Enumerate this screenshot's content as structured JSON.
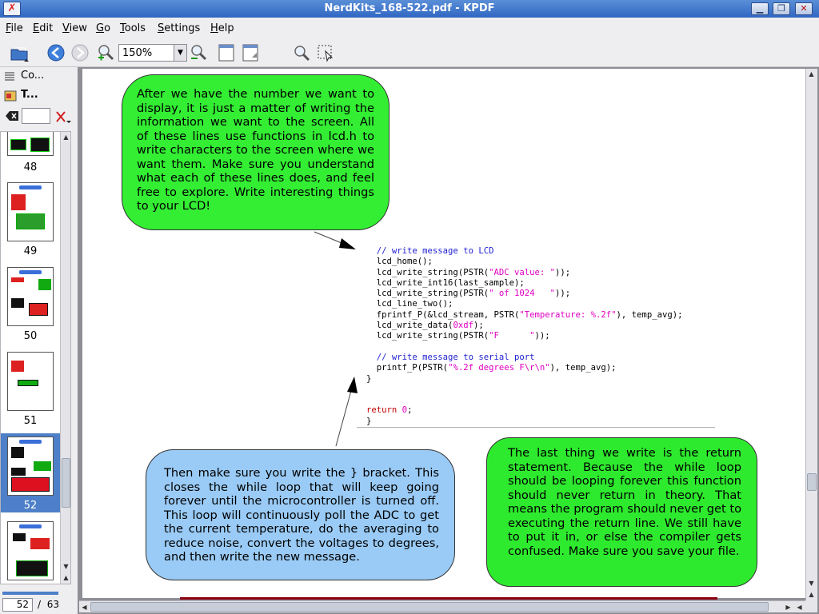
{
  "window": {
    "title": "NerdKits_168-522.pdf - KPDF",
    "app_icon_glyph": "✗"
  },
  "menu": {
    "items": [
      "File",
      "Edit",
      "View",
      "Go",
      "Tools",
      "Settings",
      "Help"
    ]
  },
  "toolbar": {
    "zoom_value": "150%"
  },
  "left_panel": {
    "tab_contents_label": "Co...",
    "tab_thumbnails_label": "T...",
    "thumbnail_pages": [
      "48",
      "49",
      "50",
      "51",
      "52"
    ],
    "selected_page": "52",
    "current_page": "52",
    "page_separator": "/",
    "total_pages": "63"
  },
  "document": {
    "bubble_top": "After we have the number we want to display, it is just a matter of writing the information we want to the screen. All of these lines use functions in lcd.h to write characters to the screen where we want them. Make sure you understand what each of these lines does, and feel free to explore. Write interesting things to your LCD!",
    "bubble_bottom_left": "Then make sure you write the } bracket. This closes the while loop that will keep going forever until the microcontroller is turned off. This loop will continuously poll the ADC to get the current temperature, do the averaging to reduce noise, convert the voltages to degrees, and then write the new message.",
    "bubble_bottom_right": "The last thing we write is the return statement. Because the while loop should be looping forever this function should never return in theory. That means the program should never get to executing the return line. We still have to put it in, or else the compiler gets confused. Make sure you save your file.",
    "code": {
      "l1_comment": "// write message to LCD",
      "l2": "lcd_home();",
      "l3_a": "lcd_write_string(PSTR(",
      "l3_str": "\"ADC value: \"",
      "l3_b": "));",
      "l4": "lcd_write_int16(last_sample);",
      "l5_a": "lcd_write_string(PSTR(",
      "l5_str": "\" of 1024   \"",
      "l5_b": "));",
      "l6": "lcd_line_two();",
      "l7_a": "fprintf_P(&lcd_stream, PSTR(",
      "l7_str": "\"Temperature: %.2f\"",
      "l7_b": "), temp_avg);",
      "l8_a": "lcd_write_data(",
      "l8_str": "0xdf",
      "l8_b": ");",
      "l9_a": "lcd_write_string(PSTR(",
      "l9_str": "\"F      \"",
      "l9_b": "));",
      "l10_comment": "// write message to serial port",
      "l11_a": "printf_P(PSTR(",
      "l11_str": "\"%.2f degrees F\\r\\n\"",
      "l11_b": "), temp_avg);",
      "l12": "}",
      "l13_kw": "return",
      "l13_num": "0",
      "l13_b": ";",
      "l14": "}"
    }
  }
}
